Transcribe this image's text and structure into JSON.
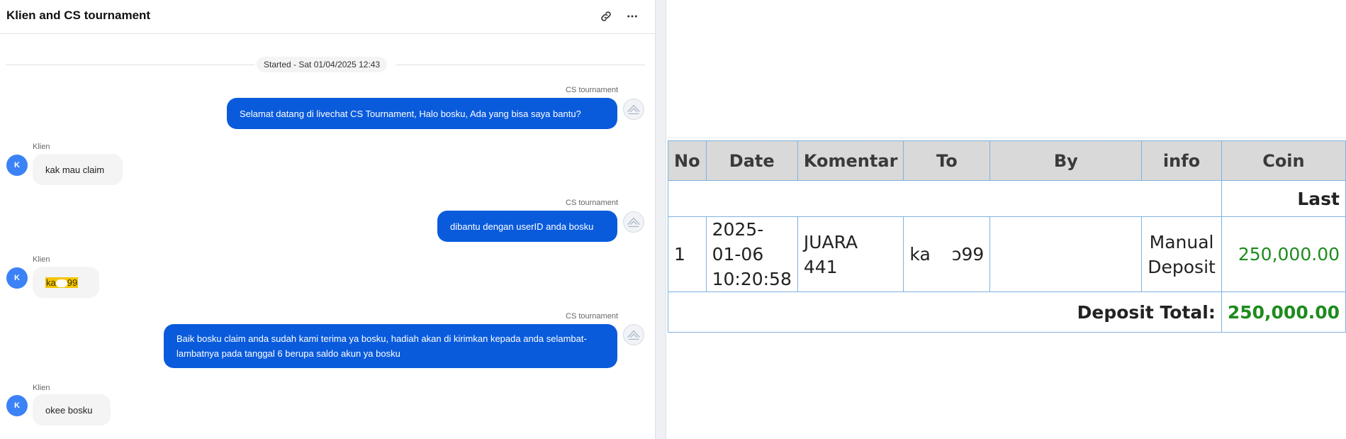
{
  "chat": {
    "title": "Klien and CS tournament",
    "started": "Started - Sat 01/04/2025 12:43",
    "messages": [
      {
        "from": "agent",
        "sender": "CS tournament",
        "text": "Selamat datang di livechat CS Tournament, Halo bosku, Ada yang bisa saya bantu?"
      },
      {
        "from": "client",
        "sender": "Klien",
        "avatar": "K",
        "text": "kak mau claim"
      },
      {
        "from": "agent",
        "sender": "CS tournament",
        "text": "dibantu dengan userID anda bosku"
      },
      {
        "from": "client",
        "sender": "Klien",
        "avatar": "K",
        "text_start": "ka",
        "text_end": "99"
      },
      {
        "from": "agent",
        "sender": "CS tournament",
        "text": "Baik bosku claim anda sudah kami terima ya bosku, hadiah akan di kirimkan kepada anda selambat-lambatnya pada tanggal 6 berupa saldo akun ya bosku"
      },
      {
        "from": "client",
        "sender": "Klien",
        "avatar": "K",
        "text": "okee bosku"
      }
    ]
  },
  "table": {
    "headers": [
      "No",
      "Date",
      "Komentar",
      "To",
      "By",
      "info",
      "Coin"
    ],
    "section_label": "Last",
    "row": {
      "no": "1",
      "date_line1": "2025-",
      "date_line2": "01-06",
      "date_line3": "10:20:58",
      "komentar_line1": "JUARA",
      "komentar_line2": "441",
      "to_start": "ka",
      "to_end": "ɔ99",
      "by": "",
      "info_line1": "Manual",
      "info_line2": "Deposit",
      "coin": "250,000.00"
    },
    "total_label": "Deposit Total:",
    "total_value": "250,000.00"
  },
  "colors": {
    "agent_bubble": "#0a5bdc",
    "client_bubble": "#f4f4f5",
    "avatar": "#3b82f6",
    "highlight": "#f5c400",
    "money_green": "#1e8b1e",
    "header_bg": "#d9d9d9",
    "grid": "#7fb2df"
  },
  "icons": [
    "link-icon",
    "more-icon",
    "cs-avatar-icon"
  ]
}
